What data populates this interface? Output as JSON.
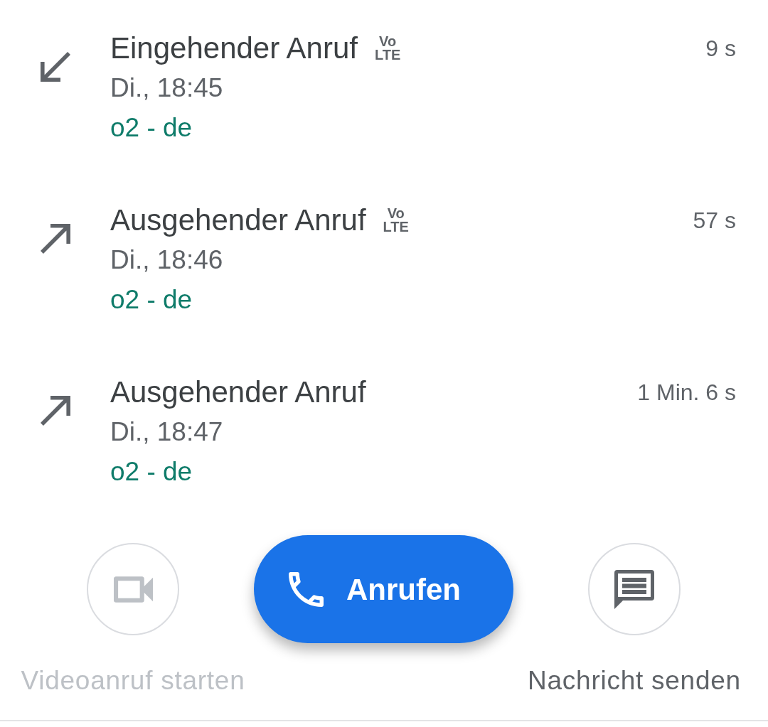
{
  "calls": [
    {
      "kind": "incoming",
      "title": "Eingehender Anruf",
      "badge_lines": [
        "Vo",
        "LTE"
      ],
      "time": "Di., 18:45",
      "network": "o2 - de",
      "duration": "9 s"
    },
    {
      "kind": "outgoing",
      "title": "Ausgehender Anruf",
      "badge_lines": [
        "Vo",
        "LTE"
      ],
      "time": "Di., 18:46",
      "network": "o2 - de",
      "duration": "57 s"
    },
    {
      "kind": "outgoing",
      "title": "Ausgehender Anruf",
      "time": "Di., 18:47",
      "network": "o2 - de",
      "duration": "1 Min. 6 s"
    }
  ],
  "actions": [
    {
      "kind": "video",
      "label": "Videoanruf starten",
      "disabled": true
    },
    {
      "kind": "call",
      "label": "Anrufen"
    },
    {
      "kind": "message",
      "label": "Nachricht senden",
      "disabled": false
    }
  ]
}
